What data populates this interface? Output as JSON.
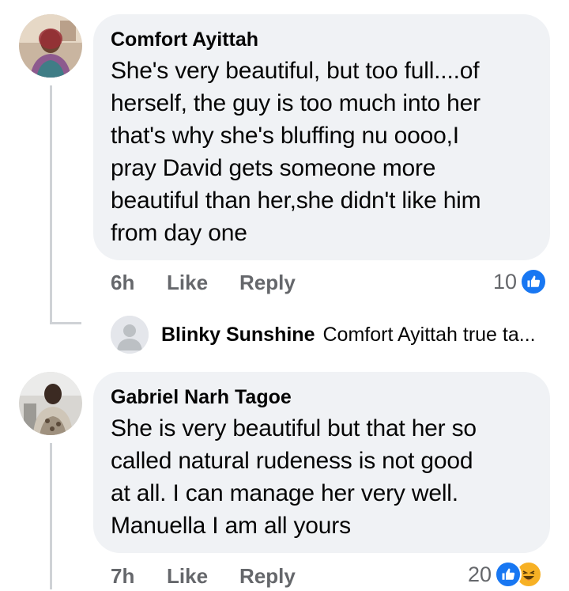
{
  "comments": [
    {
      "author": "Comfort Ayittah",
      "text": "She's very beautiful, but too full....of\nherself, the guy is too much into her\nthat's why she's bluffing  nu oooo,I\npray David gets someone more\nbeautiful than her,she didn't like him\nfrom day one",
      "time": "6h",
      "like_label": "Like",
      "reply_label": "Reply",
      "reaction_count": "10",
      "reactions": [
        "like-icon"
      ]
    },
    {
      "author": "Gabriel Narh Tagoe",
      "text": "She is very beautiful but that her so\ncalled natural rudeness is not good\nat all. I can manage her very well.\nManuella I am all yours",
      "time": "7h",
      "like_label": "Like",
      "reply_label": "Reply",
      "reaction_count": "20",
      "reactions": [
        "like-icon",
        "haha-icon"
      ]
    }
  ],
  "reply_preview": {
    "author": "Blinky Sunshine",
    "snippet": "Comfort Ayittah true ta..."
  },
  "colors": {
    "bubble": "#f0f2f5",
    "meta": "#65676b",
    "like": "#1877f2",
    "haha": "#f7b125",
    "thread_line": "#cfd2d6"
  }
}
